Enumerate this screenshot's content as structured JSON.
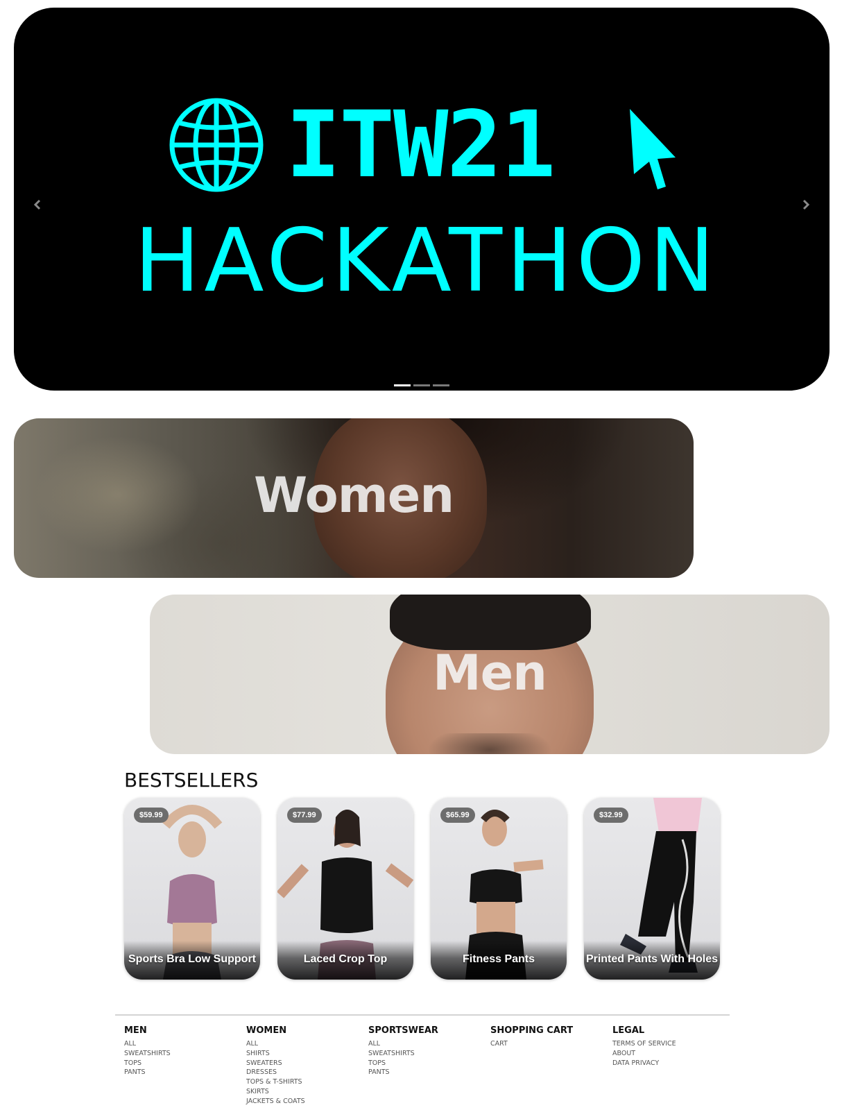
{
  "hero": {
    "title": "ITW21",
    "subtitle": "HACKATHON",
    "accent_color": "#00ffff",
    "background_color": "#000000",
    "icons": [
      "globe-icon",
      "cursor-icon",
      "chevron-left-icon",
      "chevron-right-icon"
    ],
    "slide_count": 3,
    "active_slide": 1
  },
  "categories": [
    {
      "label": "Women"
    },
    {
      "label": "Men"
    }
  ],
  "bestsellers": {
    "title": "BESTSELLERS",
    "products": [
      {
        "name": "Sports Bra Low Support",
        "price": "$59.99"
      },
      {
        "name": "Laced Crop Top",
        "price": "$77.99"
      },
      {
        "name": "Fitness Pants",
        "price": "$65.99"
      },
      {
        "name": "Printed Pants With Holes",
        "price": "$32.99"
      }
    ]
  },
  "footer": {
    "columns": [
      {
        "heading": "MEN",
        "links": [
          "ALL",
          "SWEATSHIRTS",
          "TOPS",
          "PANTS"
        ]
      },
      {
        "heading": "WOMEN",
        "links": [
          "ALL",
          "SHIRTS",
          "SWEATERS",
          "DRESSES",
          "TOPS & T-SHIRTS",
          "SKIRTS",
          "JACKETS & COATS"
        ]
      },
      {
        "heading": "SPORTSWEAR",
        "links": [
          "ALL",
          "SWEATSHIRTS",
          "TOPS",
          "PANTS"
        ]
      },
      {
        "heading": "SHOPPING CART",
        "links": [
          "CART"
        ]
      },
      {
        "heading": "LEGAL",
        "links": [
          "TERMS OF SERVICE",
          "ABOUT",
          "DATA PRIVACY"
        ]
      }
    ]
  }
}
